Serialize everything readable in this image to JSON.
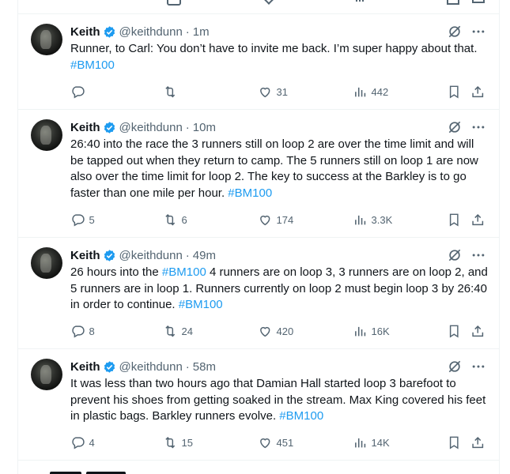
{
  "tweets": [
    {
      "name": "Keith",
      "handle": "@keithdunn",
      "time": "1m",
      "text": [
        "Runner, to Carl: You don’t have to invite me back. I’m super happy about that. "
      ],
      "hashtag": "#BM100",
      "replies": "",
      "retweets": "",
      "likes": "31",
      "views": "442"
    },
    {
      "name": "Keith",
      "handle": "@keithdunn",
      "time": "10m",
      "text": [
        "26:40 into the race the 3 runners still on loop 2 are over the time limit and will be tapped out when they return to camp. The 5 runners still on loop 1 are now also over the time limit for loop 2.  The key to success at the Barkley is to go faster than one mile per hour. "
      ],
      "hashtag": "#BM100",
      "replies": "5",
      "retweets": "6",
      "likes": "174",
      "views": "3.3K"
    },
    {
      "name": "Keith",
      "handle": "@keithdunn",
      "time": "49m",
      "text_pre": "26 hours into the ",
      "hashtag_inline": "#BM100",
      "text_post": " 4 runners are on loop 3, 3 runners are on loop 2, and 5 runners are in loop 1.  Runners currently on loop 2 must begin loop 3 by 26:40 in order to continue. ",
      "hashtag": "#BM100",
      "replies": "8",
      "retweets": "24",
      "likes": "420",
      "views": "16K"
    },
    {
      "name": "Keith",
      "handle": "@keithdunn",
      "time": "58m",
      "text": [
        "It was less than two hours ago that Damian Hall started loop 3 barefoot to prevent his shoes from getting soaked in the stream.  Max King covered his feet in plastic bags.  Barkley runners evolve. "
      ],
      "hashtag": "#BM100",
      "replies": "4",
      "retweets": "15",
      "likes": "451",
      "views": "14K"
    }
  ]
}
